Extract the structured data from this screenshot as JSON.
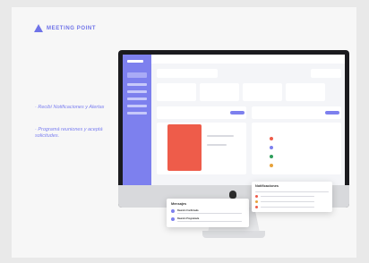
{
  "brand": {
    "name": "MEETING POINT",
    "color": "#6f73e8"
  },
  "features": [
    "· Recibí Notificaciones y Alertas",
    "· Programá reuniones y aceptá solicitudes."
  ],
  "popups": {
    "messages": {
      "title": "Mensajes",
      "items": [
        {
          "title": "Reunión Confirmada"
        },
        {
          "title": "Reunión Programada"
        }
      ]
    },
    "notifications": {
      "title": "Notificaciones"
    }
  },
  "icons": [
    "apple-logo-icon"
  ],
  "colors": {
    "sidebar": "#7d80ee",
    "alert": "#ee5c4a"
  }
}
